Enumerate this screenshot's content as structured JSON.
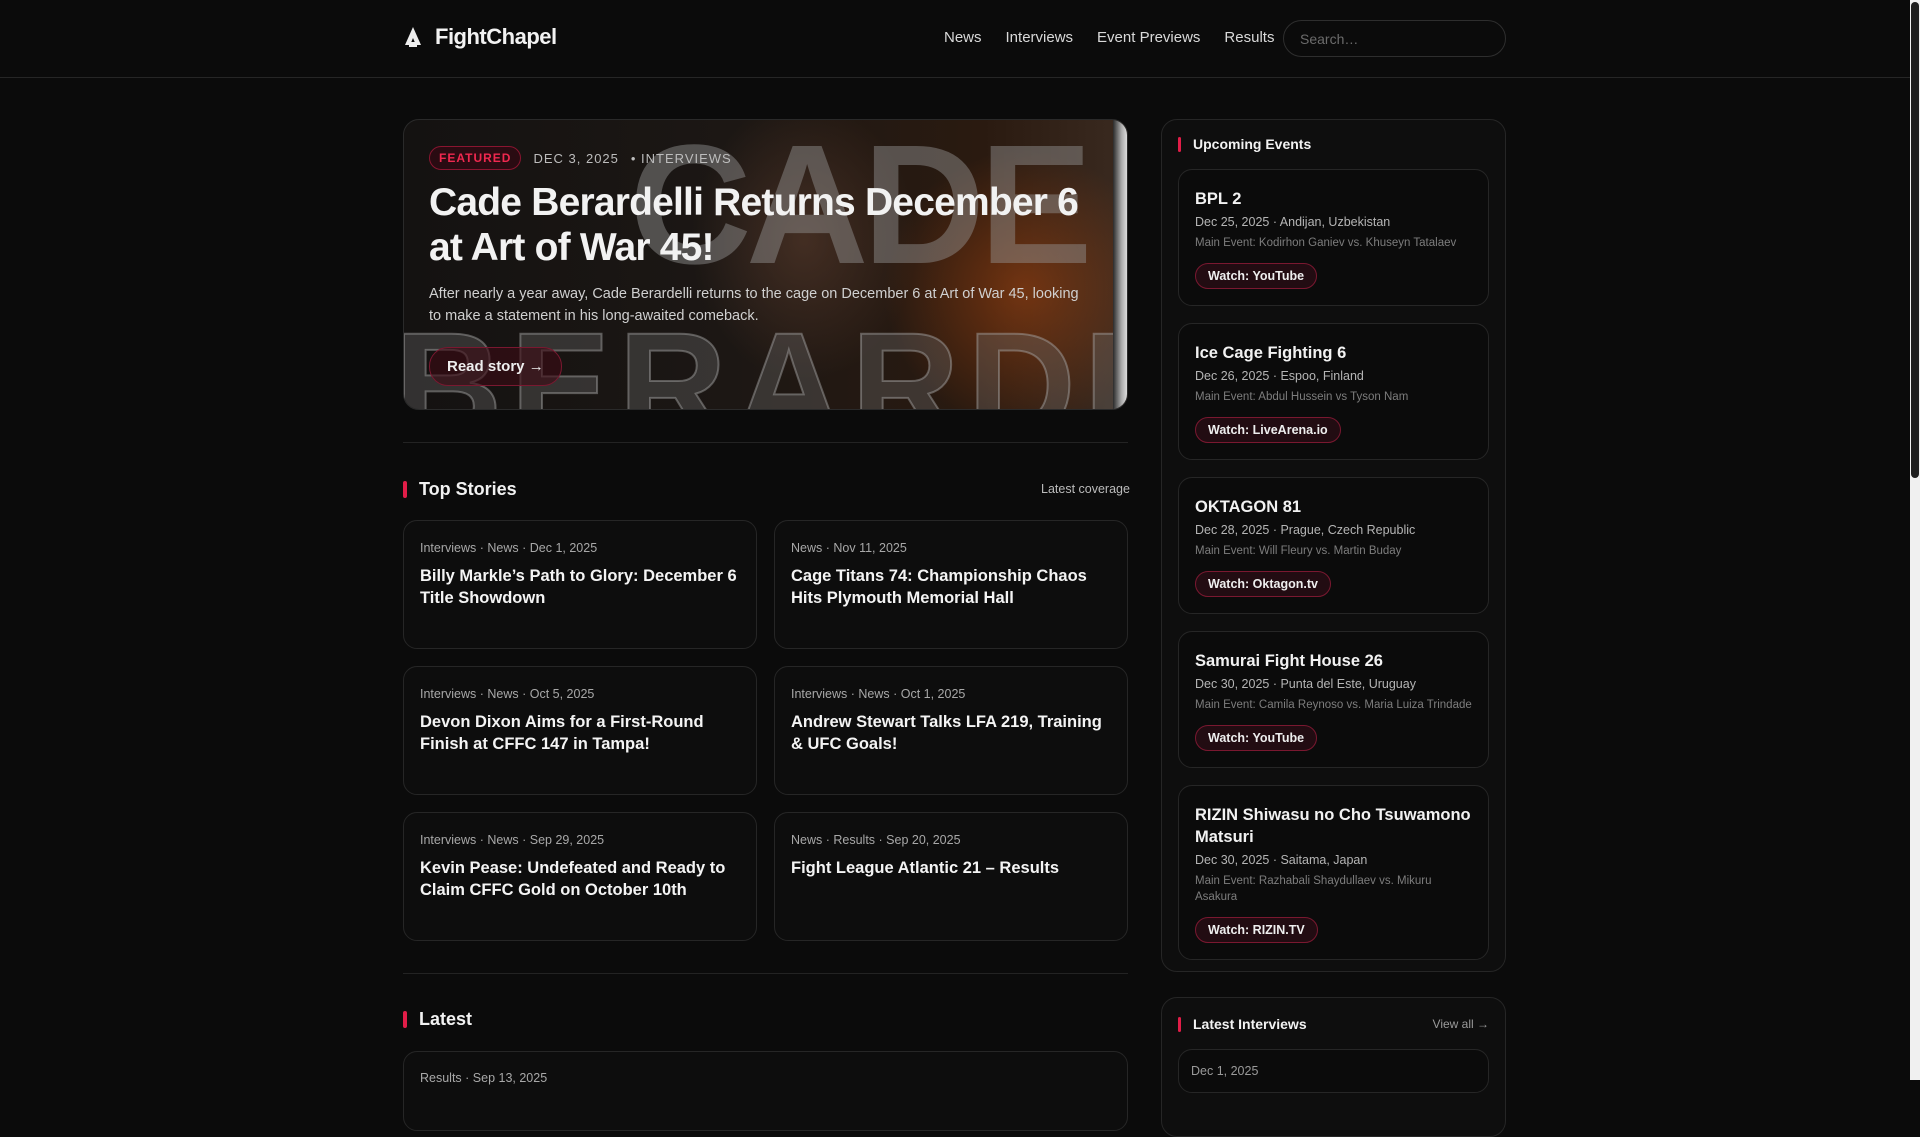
{
  "brand": {
    "name": "FightChapel"
  },
  "nav": [
    "News",
    "Interviews",
    "Event Previews",
    "Results"
  ],
  "search": {
    "placeholder": "Search…"
  },
  "hero": {
    "badge": "FEATURED",
    "date": "DEC 3, 2025",
    "category": "• INTERVIEWS",
    "title": "Cade Berardelli Returns December 6 at Art of War 45!",
    "description": "After nearly a year away, Cade Berardelli returns to the cage on December 6 at Art of War 45, looking to make a statement in his long-awaited comeback.",
    "button": "Read story →",
    "image_lettering": [
      "CADE",
      "BERARDELLI"
    ]
  },
  "top_stories": {
    "title": "Top Stories",
    "right": "Latest coverage",
    "items": [
      {
        "meta": "Interviews · News · Dec 1, 2025",
        "title": "Billy Markle’s Path to Glory: December 6 Title Showdown"
      },
      {
        "meta": "News · Nov 11, 2025",
        "title": "Cage Titans 74: Championship Chaos Hits Plymouth Memorial Hall"
      },
      {
        "meta": "Interviews · News · Oct 5, 2025",
        "title": "Devon Dixon Aims for a First-Round Finish at CFFC 147 in Tampa!"
      },
      {
        "meta": "Interviews · News · Oct 1, 2025",
        "title": "Andrew Stewart Talks LFA 219, Training & UFC Goals!"
      },
      {
        "meta": "Interviews · News · Sep 29, 2025",
        "title": "Kevin Pease: Undefeated and Ready to Claim CFFC Gold on October 10th"
      },
      {
        "meta": "News · Results · Sep 20, 2025",
        "title": "Fight League Atlantic 21 – Results"
      }
    ]
  },
  "latest": {
    "title": "Latest",
    "items": [
      {
        "meta": "Results · Sep 13, 2025"
      }
    ]
  },
  "upcoming": {
    "title": "Upcoming Events",
    "events": [
      {
        "title": "BPL 2",
        "date": "Dec 25, 2025 · Andijan, Uzbekistan",
        "main": "Main Event: Kodirhon Ganiev vs. Khuseyn Tatalaev",
        "watch": "Watch: YouTube"
      },
      {
        "title": "Ice Cage Fighting 6",
        "date": "Dec 26, 2025 · Espoo, Finland",
        "main": "Main Event: Abdul Hussein vs Tyson Nam",
        "watch": "Watch: LiveArena.io"
      },
      {
        "title": "OKTAGON 81",
        "date": "Dec 28, 2025 · Prague, Czech Republic",
        "main": "Main Event: Will Fleury vs. Martin Buday",
        "watch": "Watch: Oktagon.tv"
      },
      {
        "title": "Samurai Fight House 26",
        "date": "Dec 30, 2025 · Punta del Este, Uruguay",
        "main": "Main Event: Camila Reynoso vs. Maria Luiza Trindade",
        "watch": "Watch: YouTube"
      },
      {
        "title": "RIZIN Shiwasu no Cho Tsuwamono Matsuri",
        "date": "Dec 30, 2025 · Saitama, Japan",
        "main": "Main Event: Razhabali Shaydullaev vs. Mikuru Asakura",
        "watch": "Watch: RIZIN.TV"
      }
    ]
  },
  "latest_interviews": {
    "title": "Latest Interviews",
    "view_all": "View all →",
    "items": [
      {
        "date": "Dec 1, 2025"
      }
    ]
  },
  "colors": {
    "accent": "#e11d48",
    "background": "#0b0b0b"
  }
}
